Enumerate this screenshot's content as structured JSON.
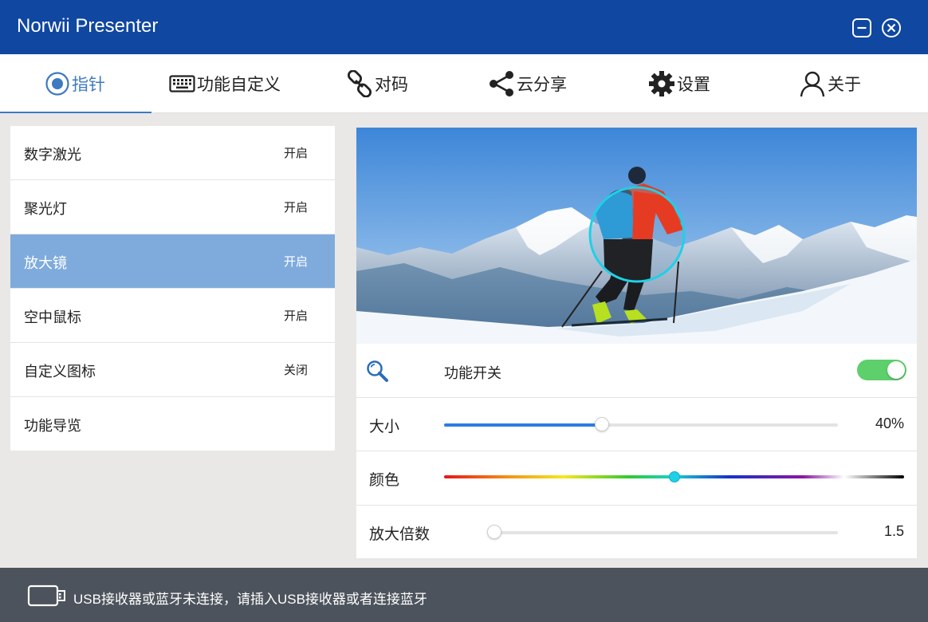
{
  "window": {
    "title": "Norwii Presenter"
  },
  "tabs": [
    {
      "label": "指针",
      "icon": "pointer-icon",
      "active": true
    },
    {
      "label": "功能自定义",
      "icon": "keyboard-icon"
    },
    {
      "label": "对码",
      "icon": "link-icon"
    },
    {
      "label": "云分享",
      "icon": "share-icon"
    },
    {
      "label": "设置",
      "icon": "gear-icon"
    },
    {
      "label": "关于",
      "icon": "user-icon"
    }
  ],
  "features": [
    {
      "label": "数字激光",
      "state": "开启"
    },
    {
      "label": "聚光灯",
      "state": "开启"
    },
    {
      "label": "放大镜",
      "state": "开启",
      "selected": true
    },
    {
      "label": "空中鼠标",
      "state": "开启"
    },
    {
      "label": "自定义图标",
      "state": "关闭"
    },
    {
      "label": "功能导览",
      "state": ""
    }
  ],
  "settings": {
    "switch_label": "功能开关",
    "switch_on": true,
    "switch_icon": "magnifier-icon",
    "size_label": "大小",
    "size_value": "40%",
    "size_fraction": 0.4,
    "color_label": "颜色",
    "color_fraction": 0.5,
    "color_selected": "#1fd0e6",
    "zoom_label": "放大倍数",
    "zoom_value": "1.5",
    "zoom_fraction": 0.0
  },
  "status": {
    "icon": "usb-icon",
    "message": "USB接收器或蓝牙未连接，请插入USB接收器或者连接蓝牙"
  },
  "colors": {
    "titlebar": "#0f47a1",
    "accent": "#3d7ac0",
    "selected_row": "#7fabdc",
    "toggle_on": "#5dcf6b",
    "slider_fill": "#2b7de3",
    "statusbar": "#4c535c"
  }
}
